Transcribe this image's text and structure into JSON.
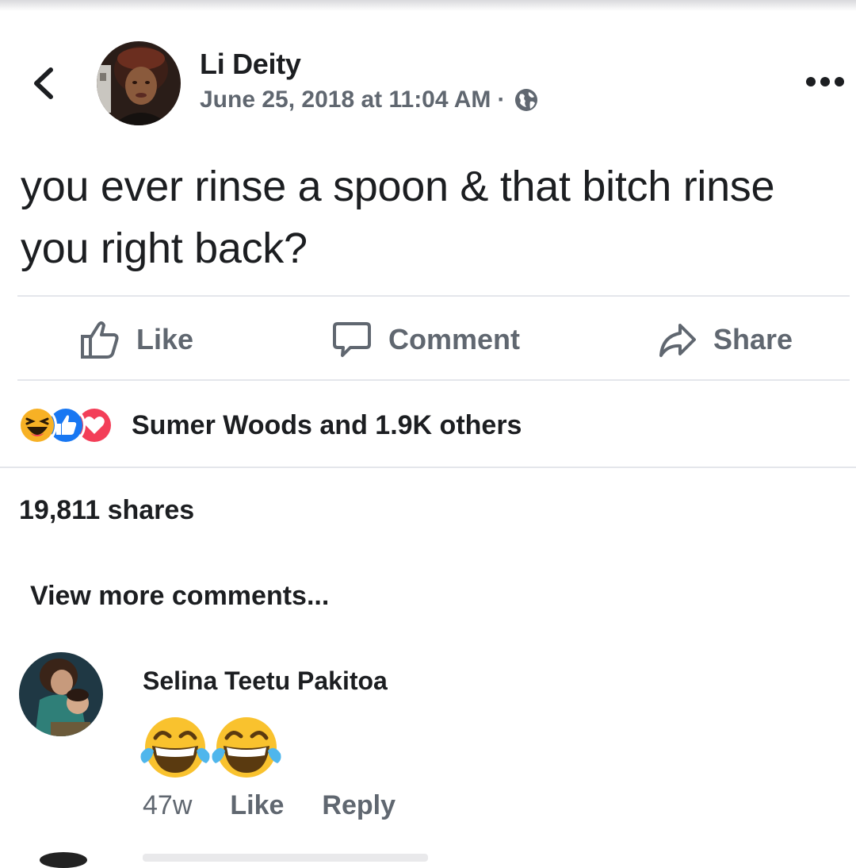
{
  "post": {
    "author": "Li Deity",
    "timestamp": "June 25, 2018 at 11:04 AM",
    "separator": "·",
    "privacy_icon": "globe-icon",
    "text": "you ever rinse a spoon & that bitch rinse you right back?"
  },
  "header": {
    "back_icon": "chevron-left-icon",
    "more_icon": "more-dots-icon"
  },
  "actions": {
    "like_label": "Like",
    "comment_label": "Comment",
    "share_label": "Share"
  },
  "reactions": {
    "icons": [
      "haha-reaction-icon",
      "like-reaction-icon",
      "love-reaction-icon"
    ],
    "summary": "Sumer Woods and 1.9K others"
  },
  "shares_count": "19,811 shares",
  "view_more_comments": "View more comments...",
  "comment": {
    "author": "Selina Teetu Pakitoa",
    "content_icons": [
      "tears-of-joy-emoji",
      "tears-of-joy-emoji"
    ],
    "age": "47w",
    "like_label": "Like",
    "reply_label": "Reply"
  },
  "colors": {
    "text_primary": "#1c1e21",
    "text_secondary": "#606770",
    "like_blue": "#1877f2",
    "love_red": "#f33e58",
    "haha_yellow": "#f7b125",
    "divider": "#e4e6eb"
  }
}
